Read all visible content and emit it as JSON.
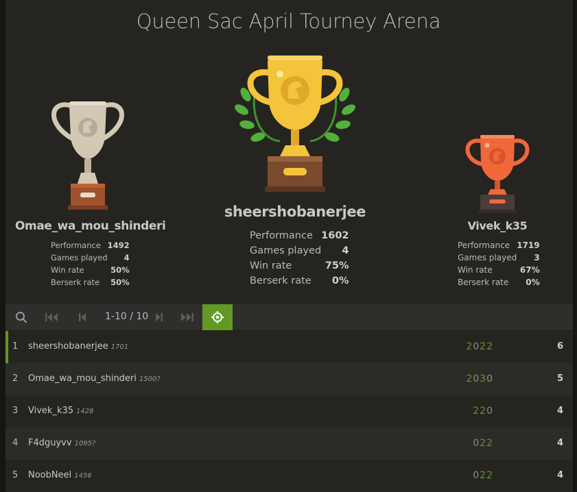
{
  "tournament": {
    "title": "Queen Sac April Tourney Arena"
  },
  "podium": [
    {
      "place": "second",
      "name": "Omae_wa_mou_shinderi",
      "stats": [
        {
          "label": "Performance",
          "value": "1492"
        },
        {
          "label": "Games played",
          "value": "4"
        },
        {
          "label": "Win rate",
          "value": "50%"
        },
        {
          "label": "Berserk rate",
          "value": "50%"
        }
      ]
    },
    {
      "place": "first",
      "name": "sheershobanerjee",
      "stats": [
        {
          "label": "Performance",
          "value": "1602"
        },
        {
          "label": "Games played",
          "value": "4"
        },
        {
          "label": "Win rate",
          "value": "75%"
        },
        {
          "label": "Berserk rate",
          "value": "0%"
        }
      ]
    },
    {
      "place": "third",
      "name": "Vivek_k35",
      "stats": [
        {
          "label": "Performance",
          "value": "1719"
        },
        {
          "label": "Games played",
          "value": "3"
        },
        {
          "label": "Win rate",
          "value": "67%"
        },
        {
          "label": "Berserk rate",
          "value": "0%"
        }
      ]
    }
  ],
  "pager": {
    "page_info": "1-10 / 10",
    "icons": [
      "search-icon",
      "first-page-icon",
      "prev-page-icon",
      "next-page-icon",
      "last-page-icon",
      "focus-me-icon"
    ]
  },
  "standings": [
    {
      "rank": "1",
      "name": "sheershobanerjee",
      "rating": "1701",
      "sheet": "2022",
      "score": "6"
    },
    {
      "rank": "2",
      "name": "Omae_wa_mou_shinderi",
      "rating": "1500?",
      "sheet": "2030",
      "score": "5"
    },
    {
      "rank": "3",
      "name": "Vivek_k35",
      "rating": "1428",
      "sheet": "220",
      "score": "4"
    },
    {
      "rank": "4",
      "name": "F4dguyvv",
      "rating": "1095?",
      "sheet": "022",
      "score": "4"
    },
    {
      "rank": "5",
      "name": "NoobNeel",
      "rating": "1456",
      "sheet": "022",
      "score": "4"
    }
  ],
  "colors": {
    "accent": "#629924",
    "background": "#262421",
    "gold": "#f4c43a",
    "silver": "#d2c8b4",
    "bronze": "#f0683a"
  }
}
